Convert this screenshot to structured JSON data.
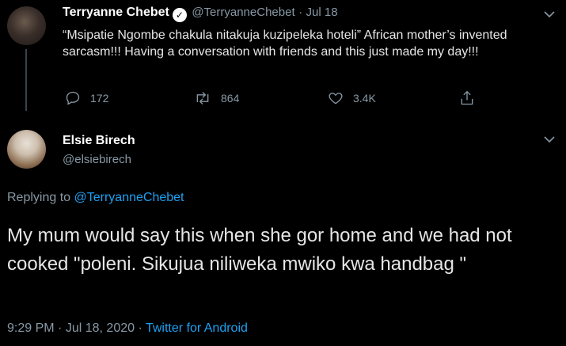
{
  "parent_tweet": {
    "author_name": "Terryanne Chebet",
    "handle": "@TerryanneChebet",
    "separator": "·",
    "date": "Jul 18",
    "text": "“Msipatie Ngombe chakula nitakuja kuzipeleka hoteli” African mother’s invented sarcasm!!!  Having a conversation with friends and this just made my day!!!",
    "replies": "172",
    "retweets": "864",
    "likes": "3.4K",
    "icons": {
      "reply": "reply-icon",
      "retweet": "retweet-icon",
      "like": "heart-icon",
      "share": "share-icon",
      "menu": "chevron-down-icon",
      "verified": "verified-badge-icon"
    }
  },
  "reply_tweet": {
    "author_name": "Elsie Birech",
    "handle": "@elsiebirech",
    "replying_to_label": "Replying to",
    "replying_to_handle": "@TerryanneChebet",
    "text": "My mum would say this when she gor home and we had not cooked \"poleni. Sikujua niliweka mwiko kwa handbag \"",
    "time": "9:29 PM",
    "separator": "·",
    "date": "Jul 18, 2020",
    "source": "Twitter for Android"
  },
  "colors": {
    "background": "#000000",
    "link": "#1da1f2",
    "muted": "#8899a6"
  }
}
